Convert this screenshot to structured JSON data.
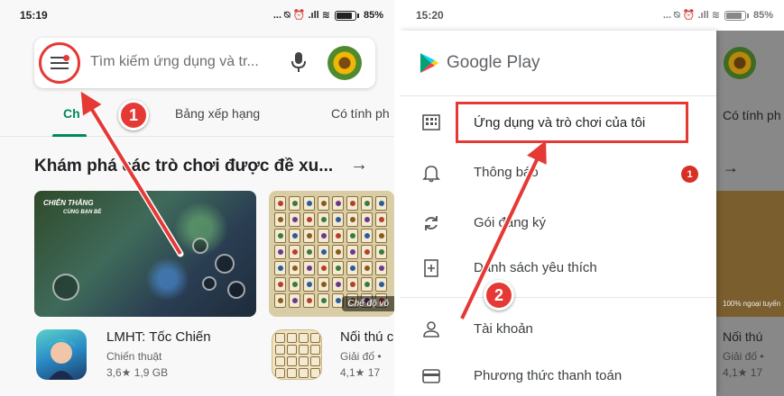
{
  "left_screen": {
    "status": {
      "time": "15:19",
      "icons": "... ⍉ ⏰ .ıll ≋",
      "battery": "85%"
    },
    "search": {
      "placeholder": "Tìm kiếm ứng dụng và tr...",
      "has_notification_dot": true
    },
    "tabs": [
      {
        "label": "Ch",
        "active": true
      },
      {
        "label": "Bảng xếp hạng",
        "active": false
      },
      {
        "label": "Có tính ph",
        "active": false
      }
    ],
    "section_title": "Khám phá các trò chơi được đề xu...",
    "section_arrow": "→",
    "game_banner": {
      "label_line1": "CHIẾN THẮNG",
      "label_line2": "CÙNG BẠN BÈ"
    },
    "puzzle_banner": {
      "mode_label": "Chế độ vô"
    },
    "apps": [
      {
        "name": "LMHT: Tốc Chiến",
        "category": "Chiến thuật",
        "meta": "3,6★  1,9 GB"
      },
      {
        "name": "Nối thú c",
        "category": "Giải đố •",
        "meta": "4,1★  17"
      }
    ]
  },
  "right_screen": {
    "status": {
      "time": "15:20",
      "icons": "... ⍉ ⏰ .ıll ≋",
      "battery": "85%"
    },
    "brand": "Google Play",
    "menu": [
      {
        "label": "Ứng dụng và trò chơi của tôi",
        "icon": "apps-grid-icon",
        "highlighted": true
      },
      {
        "label": "Thông báo",
        "icon": "bell-icon",
        "badge": "1"
      },
      {
        "label": "Gói đăng ký",
        "icon": "refresh-icon"
      },
      {
        "label": "Danh sách yêu thích",
        "icon": "bookmark-icon"
      },
      {
        "label": "Tài khoản",
        "icon": "person-icon"
      },
      {
        "label": "Phương thức thanh toán",
        "icon": "card-icon"
      }
    ],
    "background_hints": {
      "tab": "Có tính ph",
      "mode": "100% ngoại tuyến",
      "app_name": "Nối thú",
      "app_category": "Giải đố •",
      "app_meta": "4,1★  17"
    }
  },
  "annotations": {
    "step1": "1",
    "step2": "2"
  },
  "colors": {
    "accent_green": "#01875f",
    "highlight_red": "#e53935",
    "badge_red": "#d93025"
  }
}
